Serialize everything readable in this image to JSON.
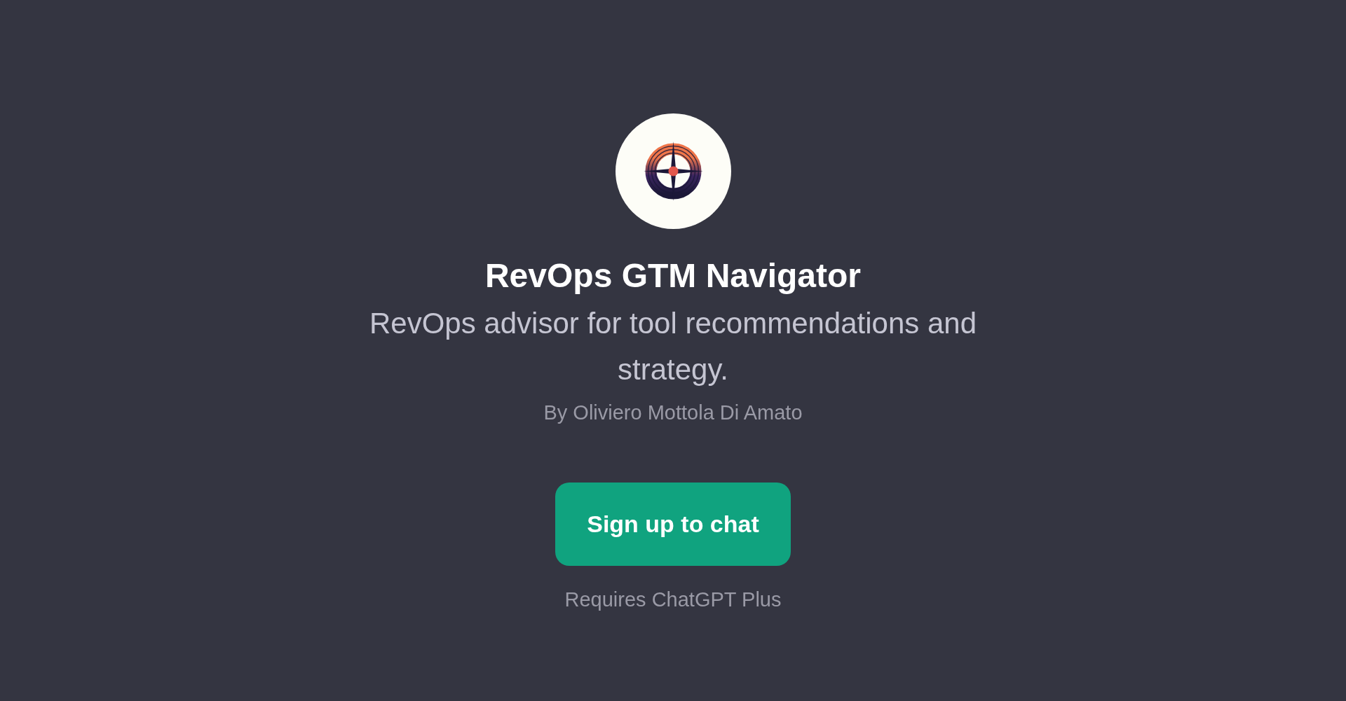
{
  "gpt": {
    "name": "RevOps GTM Navigator",
    "description": "RevOps advisor for tool recommendations and strategy.",
    "author": "By Oliviero Mottola Di Amato"
  },
  "signup_button": {
    "label": "Sign up to chat"
  },
  "note": "Requires ChatGPT Plus"
}
